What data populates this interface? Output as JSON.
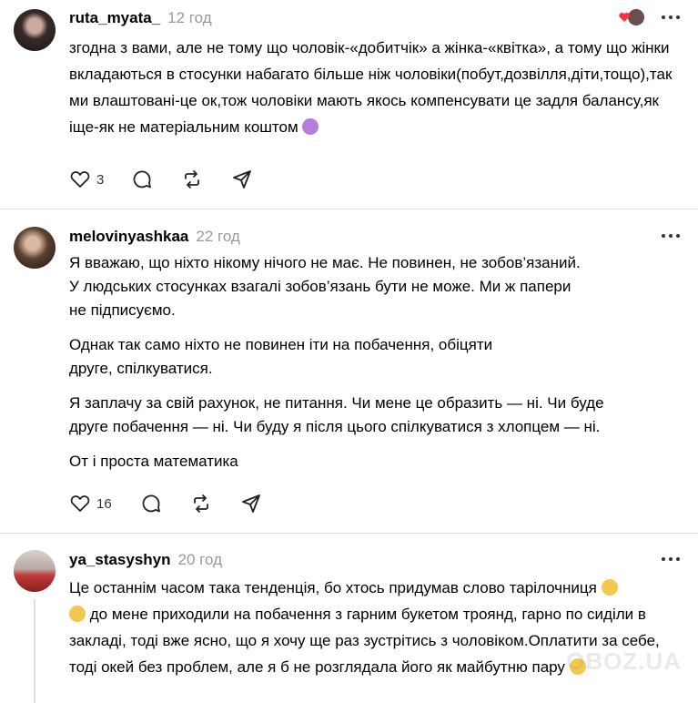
{
  "comments": [
    {
      "username": "ruta_myata_",
      "time": "12 год",
      "paragraphs": [
        "згодна з вами, але не тому що чоловік-«добитчік» а жінка-«квітка», а тому що жінки вкладаються в стосунки набагато більше ніж чоловіки(побут,дозвілля,діти,тощо),так ми влаштовані-це ок,тож чоловіки мають якось компенсувати це задля балансу,як іще-як не матеріальним коштом"
      ],
      "likes": "3",
      "liked_by_author": true
    },
    {
      "username": "melovinyashkaa",
      "time": "22 год",
      "paragraphs": [
        "Я вважаю, що ніхто нікому нічого не має. Не повинен, не зобов’язаний.\nУ людських стосунках взагалі зобов’язань бути не може. Ми ж папери\nне підписуємо.",
        "Однак так само ніхто не повинен іти на побачення, обіцяти\nдруге, спілкуватися.",
        "Я заплачу за свій рахунок, не питання. Чи мене це образить — ні. Чи буде\nдруге побачення — ні. Чи буду я після цього спілкуватися з хлопцем — ні.",
        "От і проста математика"
      ],
      "likes": "16"
    },
    {
      "username": "ya_stasyshyn",
      "time": "20 год",
      "paragraphs": [
        "Це останнім часом така тенденція, бо хтось придумав слово тарілочниця",
        "до мене приходили на побачення з гарним букетом троянд, гарно по сиділи в закладі, тоді вже ясно, що я хочу ще раз зустрітись з чоловіком.Оплатити за себе, тоді окей без проблем, але я б не розглядала його як майбутню пару"
      ]
    }
  ],
  "watermark": "OBOZ.UA",
  "colors": {
    "like": "#ff3040",
    "muted": "#999999",
    "divider": "#e2e2e2"
  }
}
